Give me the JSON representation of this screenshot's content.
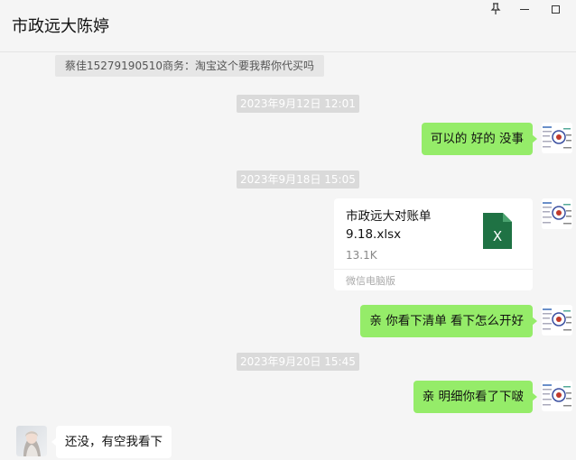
{
  "window": {
    "title": "市政远大陈婷",
    "pin_icon": "pin-icon",
    "minimize_icon": "minimize-icon",
    "maximize_icon": "maximize-icon"
  },
  "messages": {
    "quote": "蔡佳15279190510商务：淘宝这个要我帮你代买吗",
    "time_1": "2023年9月12日 12:01",
    "msg_1": "可以的  好的 没事",
    "time_2": "2023年9月18日 15:05",
    "file": {
      "name": "市政远大对账单9.18.xlsx",
      "size": "13.1K",
      "source": "微信电脑版",
      "icon": "excel-file-icon",
      "icon_letter": "X"
    },
    "msg_2": "亲 你看下清单 看下怎么开好",
    "time_3": "2023年9月20日 15:45",
    "msg_3": "亲 明细你看了下啵",
    "msg_4": "还没，有空我看下"
  },
  "colors": {
    "sent_bubble": "#95ec69",
    "received_bubble": "#ffffff",
    "background": "#f5f5f5",
    "excel_green": "#1f7244"
  }
}
